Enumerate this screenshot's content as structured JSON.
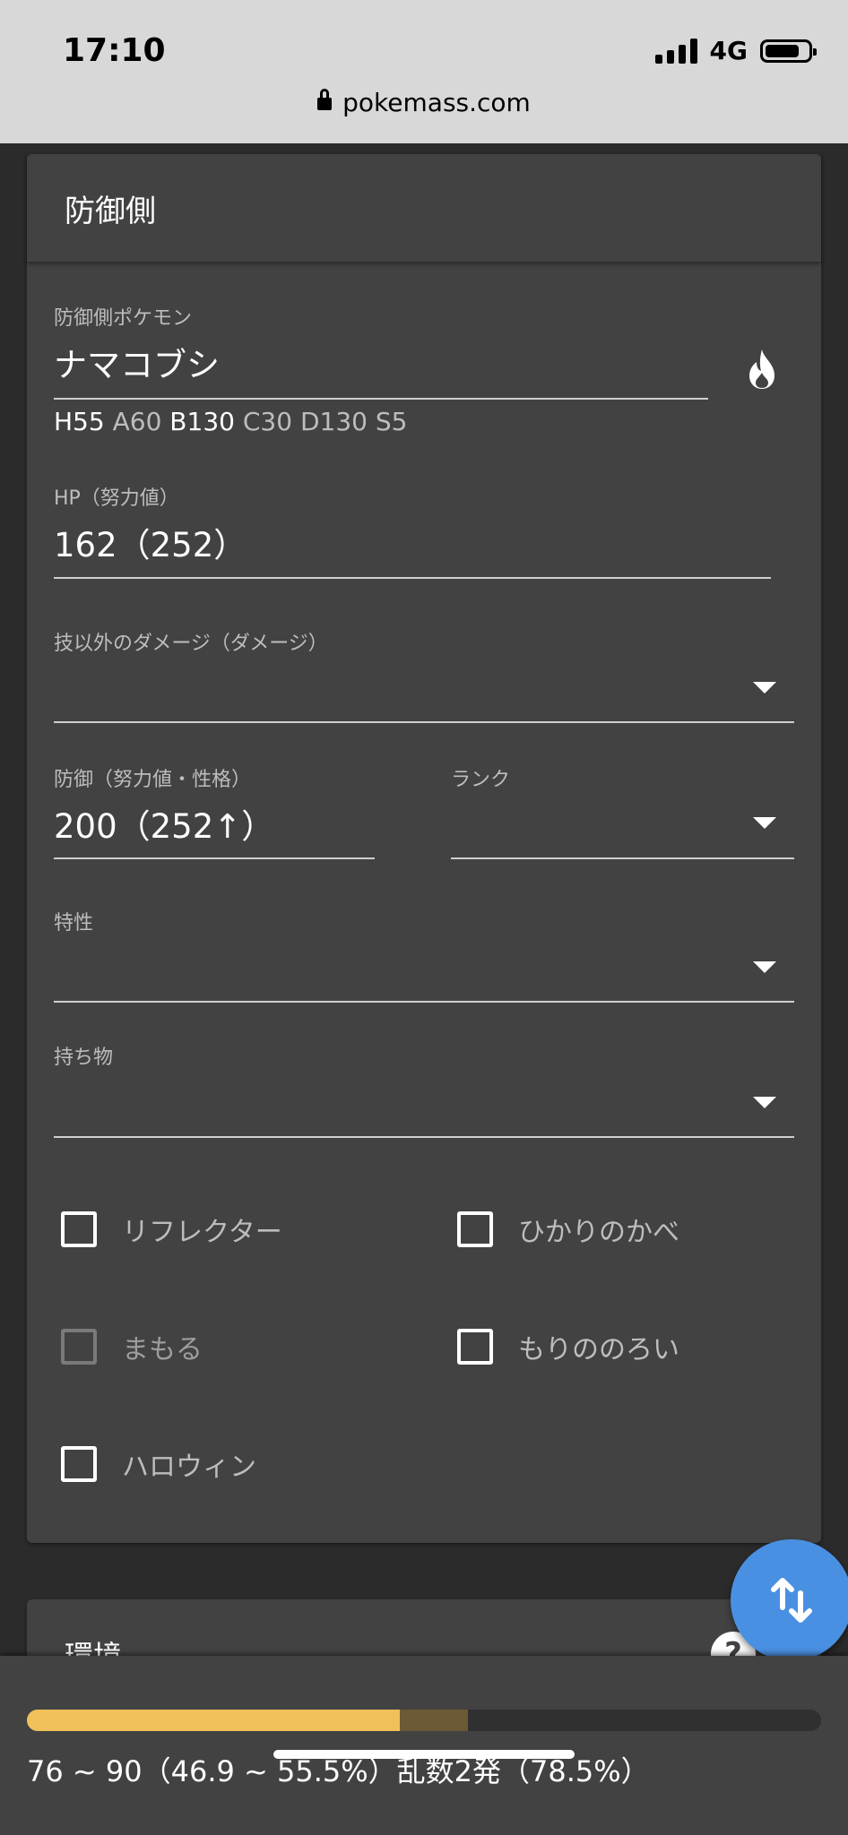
{
  "status_bar": {
    "time": "17:10",
    "network": "4G",
    "battery_level": 0.8
  },
  "browser": {
    "url": "pokemass.com"
  },
  "defender_card": {
    "title": "防御側",
    "pokemon": {
      "label": "防御側ポケモン",
      "value": "ナマコブシ"
    },
    "stats": {
      "H": "H55",
      "A": "A60",
      "B": "B130",
      "C": "C30",
      "D": "D130",
      "S": "S5"
    },
    "hp": {
      "label": "HP（努力値）",
      "value": "162（252）"
    },
    "other_damage": {
      "label": "技以外のダメージ（ダメージ）",
      "value": ""
    },
    "defense": {
      "label": "防御（努力値・性格）",
      "value": "200（252↑）"
    },
    "rank": {
      "label": "ランク",
      "value": ""
    },
    "ability": {
      "label": "特性",
      "value": ""
    },
    "item": {
      "label": "持ち物",
      "value": ""
    },
    "checkboxes": {
      "reflect": {
        "label": "リフレクター",
        "checked": false,
        "disabled": false
      },
      "light_screen": {
        "label": "ひかりのかべ",
        "checked": false,
        "disabled": false
      },
      "protect": {
        "label": "まもる",
        "checked": false,
        "disabled": true
      },
      "forests_curse": {
        "label": "もりののろい",
        "checked": false,
        "disabled": false
      },
      "halloween": {
        "label": "ハロウィン",
        "checked": false,
        "disabled": false
      }
    }
  },
  "environment_card": {
    "title": "環境"
  },
  "result": {
    "text": "76 ~ 90（46.9 ~ 55.5%）乱数2発（78.5%）",
    "min_percent": 46.9,
    "max_percent": 55.5
  },
  "colors": {
    "accent": "#4a90e2",
    "bar_min": "#f0c05a",
    "bar_range": "#6b5a35",
    "card": "#424242",
    "background": "#2b2b2b"
  }
}
